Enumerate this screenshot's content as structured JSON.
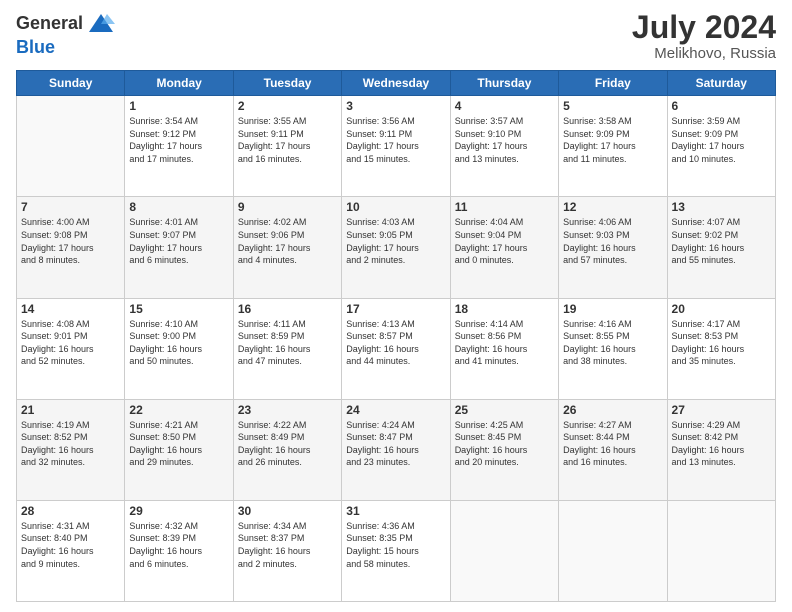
{
  "header": {
    "logo_general": "General",
    "logo_blue": "Blue",
    "month_year": "July 2024",
    "location": "Melikhovo, Russia"
  },
  "days_of_week": [
    "Sunday",
    "Monday",
    "Tuesday",
    "Wednesday",
    "Thursday",
    "Friday",
    "Saturday"
  ],
  "weeks": [
    [
      {
        "day": "",
        "info": ""
      },
      {
        "day": "1",
        "info": "Sunrise: 3:54 AM\nSunset: 9:12 PM\nDaylight: 17 hours\nand 17 minutes."
      },
      {
        "day": "2",
        "info": "Sunrise: 3:55 AM\nSunset: 9:11 PM\nDaylight: 17 hours\nand 16 minutes."
      },
      {
        "day": "3",
        "info": "Sunrise: 3:56 AM\nSunset: 9:11 PM\nDaylight: 17 hours\nand 15 minutes."
      },
      {
        "day": "4",
        "info": "Sunrise: 3:57 AM\nSunset: 9:10 PM\nDaylight: 17 hours\nand 13 minutes."
      },
      {
        "day": "5",
        "info": "Sunrise: 3:58 AM\nSunset: 9:09 PM\nDaylight: 17 hours\nand 11 minutes."
      },
      {
        "day": "6",
        "info": "Sunrise: 3:59 AM\nSunset: 9:09 PM\nDaylight: 17 hours\nand 10 minutes."
      }
    ],
    [
      {
        "day": "7",
        "info": "Sunrise: 4:00 AM\nSunset: 9:08 PM\nDaylight: 17 hours\nand 8 minutes."
      },
      {
        "day": "8",
        "info": "Sunrise: 4:01 AM\nSunset: 9:07 PM\nDaylight: 17 hours\nand 6 minutes."
      },
      {
        "day": "9",
        "info": "Sunrise: 4:02 AM\nSunset: 9:06 PM\nDaylight: 17 hours\nand 4 minutes."
      },
      {
        "day": "10",
        "info": "Sunrise: 4:03 AM\nSunset: 9:05 PM\nDaylight: 17 hours\nand 2 minutes."
      },
      {
        "day": "11",
        "info": "Sunrise: 4:04 AM\nSunset: 9:04 PM\nDaylight: 17 hours\nand 0 minutes."
      },
      {
        "day": "12",
        "info": "Sunrise: 4:06 AM\nSunset: 9:03 PM\nDaylight: 16 hours\nand 57 minutes."
      },
      {
        "day": "13",
        "info": "Sunrise: 4:07 AM\nSunset: 9:02 PM\nDaylight: 16 hours\nand 55 minutes."
      }
    ],
    [
      {
        "day": "14",
        "info": "Sunrise: 4:08 AM\nSunset: 9:01 PM\nDaylight: 16 hours\nand 52 minutes."
      },
      {
        "day": "15",
        "info": "Sunrise: 4:10 AM\nSunset: 9:00 PM\nDaylight: 16 hours\nand 50 minutes."
      },
      {
        "day": "16",
        "info": "Sunrise: 4:11 AM\nSunset: 8:59 PM\nDaylight: 16 hours\nand 47 minutes."
      },
      {
        "day": "17",
        "info": "Sunrise: 4:13 AM\nSunset: 8:57 PM\nDaylight: 16 hours\nand 44 minutes."
      },
      {
        "day": "18",
        "info": "Sunrise: 4:14 AM\nSunset: 8:56 PM\nDaylight: 16 hours\nand 41 minutes."
      },
      {
        "day": "19",
        "info": "Sunrise: 4:16 AM\nSunset: 8:55 PM\nDaylight: 16 hours\nand 38 minutes."
      },
      {
        "day": "20",
        "info": "Sunrise: 4:17 AM\nSunset: 8:53 PM\nDaylight: 16 hours\nand 35 minutes."
      }
    ],
    [
      {
        "day": "21",
        "info": "Sunrise: 4:19 AM\nSunset: 8:52 PM\nDaylight: 16 hours\nand 32 minutes."
      },
      {
        "day": "22",
        "info": "Sunrise: 4:21 AM\nSunset: 8:50 PM\nDaylight: 16 hours\nand 29 minutes."
      },
      {
        "day": "23",
        "info": "Sunrise: 4:22 AM\nSunset: 8:49 PM\nDaylight: 16 hours\nand 26 minutes."
      },
      {
        "day": "24",
        "info": "Sunrise: 4:24 AM\nSunset: 8:47 PM\nDaylight: 16 hours\nand 23 minutes."
      },
      {
        "day": "25",
        "info": "Sunrise: 4:25 AM\nSunset: 8:45 PM\nDaylight: 16 hours\nand 20 minutes."
      },
      {
        "day": "26",
        "info": "Sunrise: 4:27 AM\nSunset: 8:44 PM\nDaylight: 16 hours\nand 16 minutes."
      },
      {
        "day": "27",
        "info": "Sunrise: 4:29 AM\nSunset: 8:42 PM\nDaylight: 16 hours\nand 13 minutes."
      }
    ],
    [
      {
        "day": "28",
        "info": "Sunrise: 4:31 AM\nSunset: 8:40 PM\nDaylight: 16 hours\nand 9 minutes."
      },
      {
        "day": "29",
        "info": "Sunrise: 4:32 AM\nSunset: 8:39 PM\nDaylight: 16 hours\nand 6 minutes."
      },
      {
        "day": "30",
        "info": "Sunrise: 4:34 AM\nSunset: 8:37 PM\nDaylight: 16 hours\nand 2 minutes."
      },
      {
        "day": "31",
        "info": "Sunrise: 4:36 AM\nSunset: 8:35 PM\nDaylight: 15 hours\nand 58 minutes."
      },
      {
        "day": "",
        "info": ""
      },
      {
        "day": "",
        "info": ""
      },
      {
        "day": "",
        "info": ""
      }
    ]
  ]
}
